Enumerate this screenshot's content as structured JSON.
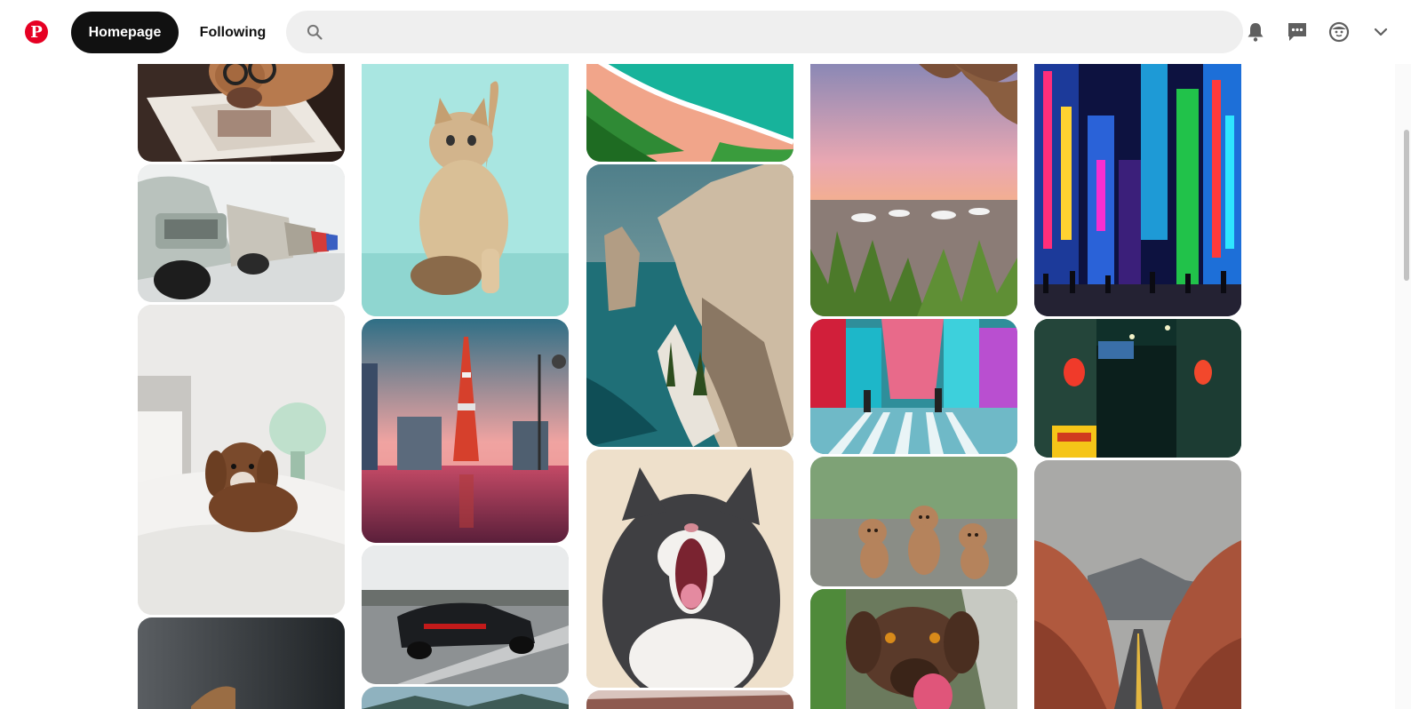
{
  "header": {
    "logo_icon": "pinterest-logo-icon",
    "logo_letter": "P",
    "nav": {
      "homepage": "Homepage",
      "following": "Following"
    },
    "search": {
      "placeholder": "",
      "value": ""
    },
    "icons": [
      "bell-icon",
      "messages-icon",
      "avatar-icon",
      "chevron-down-icon"
    ]
  },
  "colors": {
    "brand": "#e60023",
    "active_tab_bg": "#111111",
    "search_bg": "#efefef"
  },
  "pins": [
    {
      "name": "pin-dog-reading-magazine",
      "subject": "dog-reading-magazine"
    },
    {
      "name": "pin-vintage-cars-row",
      "subject": "vintage-cars"
    },
    {
      "name": "pin-puppy-on-bed",
      "subject": "puppy-on-bed"
    },
    {
      "name": "pin-dark-photo",
      "subject": "dark-photo"
    },
    {
      "name": "pin-kitten-raising-paw",
      "subject": "kitten"
    },
    {
      "name": "pin-tokyo-tower-sunset",
      "subject": "tokyo-tower"
    },
    {
      "name": "pin-black-sports-car",
      "subject": "sports-car"
    },
    {
      "name": "pin-teal-landscape",
      "subject": "landscape"
    },
    {
      "name": "pin-aerial-beach",
      "subject": "aerial-beach"
    },
    {
      "name": "pin-cliff-coast",
      "subject": "cliff-coast"
    },
    {
      "name": "pin-yawning-cat",
      "subject": "yawning-cat"
    },
    {
      "name": "pin-partial-photo",
      "subject": "partial"
    },
    {
      "name": "pin-beach-sunset",
      "subject": "beach-sunset"
    },
    {
      "name": "pin-neon-crosswalk",
      "subject": "neon-crosswalk"
    },
    {
      "name": "pin-three-puppies",
      "subject": "three-puppies"
    },
    {
      "name": "pin-dog-licking",
      "subject": "dog-licking"
    },
    {
      "name": "pin-neon-city-night",
      "subject": "neon-city"
    },
    {
      "name": "pin-japanese-alley",
      "subject": "japanese-alley"
    },
    {
      "name": "pin-desert-road",
      "subject": "desert-road"
    }
  ]
}
